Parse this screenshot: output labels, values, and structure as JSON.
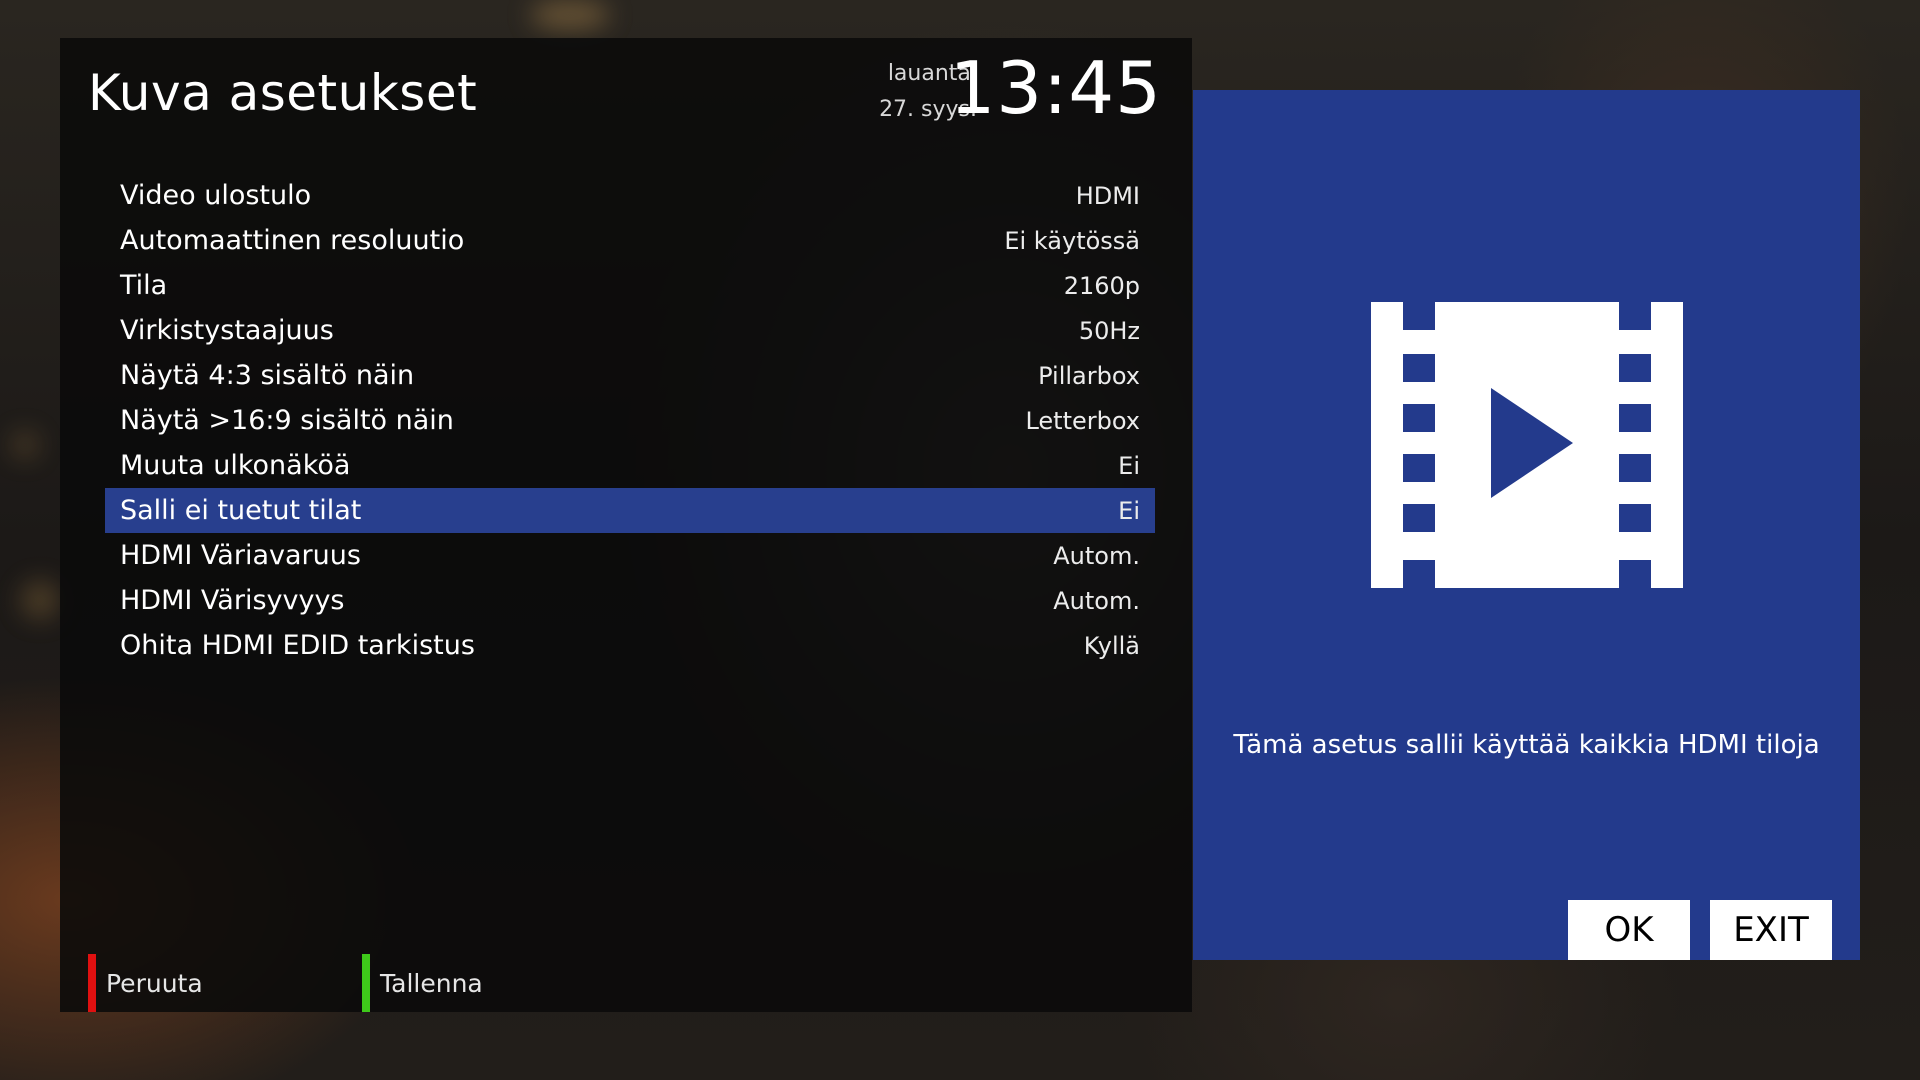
{
  "header": {
    "title": "Kuva asetukset",
    "weekday": "lauantai",
    "date": "27. syys.",
    "time": "13:45"
  },
  "settings": [
    {
      "label": "Video ulostulo",
      "value": "HDMI"
    },
    {
      "label": "Automaattinen resoluutio",
      "value": "Ei käytössä"
    },
    {
      "label": "Tila",
      "value": "2160p"
    },
    {
      "label": "Virkistystaajuus",
      "value": "50Hz"
    },
    {
      "label": "Näytä 4:3 sisältö näin",
      "value": "Pillarbox"
    },
    {
      "label": "Näytä >16:9 sisältö näin",
      "value": "Letterbox"
    },
    {
      "label": "Muuta ulkonäköä",
      "value": "Ei"
    },
    {
      "label": "Salli ei tuetut tilat",
      "value": "Ei"
    },
    {
      "label": "HDMI Väriavaruus",
      "value": "Autom."
    },
    {
      "label": "HDMI Värisyvyys",
      "value": "Autom."
    },
    {
      "label": "Ohita HDMI EDID tarkistus",
      "value": "Kyllä"
    }
  ],
  "selected_index": 7,
  "footer": {
    "cancel_label": "Peruuta",
    "save_label": "Tallenna"
  },
  "info": {
    "description": "Tämä asetus sallii käyttää kaikkia HDMI tiloja",
    "icon": "film-play-icon"
  },
  "dialog": {
    "ok_label": "OK",
    "exit_label": "EXIT"
  },
  "colors": {
    "selection": "#283f8e",
    "info_panel": "#233a8c",
    "cancel_key": "#e01010",
    "save_key": "#3ec91a"
  }
}
